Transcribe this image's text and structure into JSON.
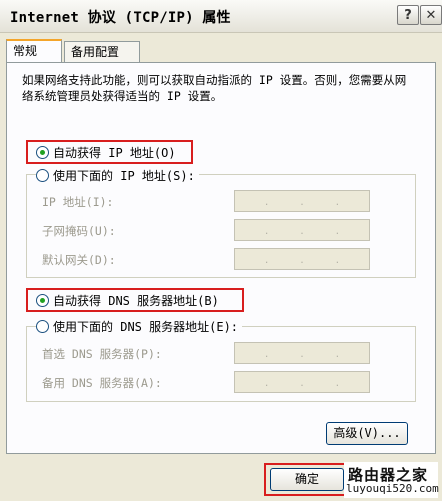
{
  "window": {
    "title": "Internet 协议 (TCP/IP) 属性",
    "help_icon": "?",
    "close_icon": "✕"
  },
  "tabs": [
    {
      "label": "常规",
      "active": true
    },
    {
      "label": "备用配置",
      "active": false
    }
  ],
  "description": "如果网络支持此功能，则可以获取自动指派的 IP 设置。否则，您需要从网络系统管理员处获得适当的 IP 设置。",
  "ip_section": {
    "auto_option": {
      "label": "自动获得 IP 地址(O)",
      "checked": true
    },
    "manual_option": {
      "label": "使用下面的 IP 地址(S):",
      "checked": false
    },
    "fields": [
      {
        "label": "IP 地址(I):"
      },
      {
        "label": "子网掩码(U):"
      },
      {
        "label": "默认网关(D):"
      }
    ]
  },
  "dns_section": {
    "auto_option": {
      "label": "自动获得 DNS 服务器地址(B)",
      "checked": true
    },
    "manual_option": {
      "label": "使用下面的 DNS 服务器地址(E):",
      "checked": false
    },
    "fields": [
      {
        "label": "首选 DNS 服务器(P):"
      },
      {
        "label": "备用 DNS 服务器(A):"
      }
    ]
  },
  "buttons": {
    "advanced": "高级(V)...",
    "ok": "确定"
  },
  "watermark": {
    "line1": "路由器之家",
    "line2": "luyouqi520.com"
  },
  "colors": {
    "highlight_box": "#d81e1e",
    "dialog_bg": "#ece9d8",
    "tab_accent": "#f4a52a",
    "radio_dot": "#21a121"
  }
}
